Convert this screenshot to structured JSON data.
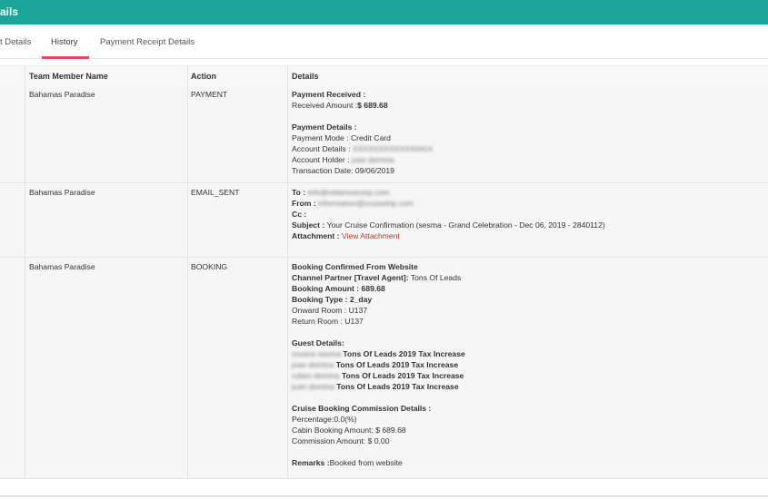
{
  "header": {
    "title": "ails"
  },
  "tabs": [
    {
      "label": "t Details"
    },
    {
      "label": "History"
    },
    {
      "label": "Payment Receipt Details"
    }
  ],
  "columns": {
    "team": "Team Member Name",
    "action": "Action",
    "details": "Details"
  },
  "rows": [
    {
      "team": "Bahamas Paradise",
      "action": "PAYMENT",
      "payment_received": "Payment Received :",
      "received_amount_label": "Received Amount :",
      "received_amount": "$ 689.68",
      "payment_details": "Payment Details :",
      "payment_mode": "Payment Mode : Credit Card",
      "account_details_label": "Account Details :",
      "account_details_value": "XXXXXXXXXXXX0414",
      "account_holder_label": "Account Holder :",
      "account_holder_value": "jose domina",
      "transaction_date": "Transaction Date: 09/06/2019"
    },
    {
      "team": "Bahamas Paradise",
      "action": "EMAIL_SENT",
      "to_label": "To :",
      "to_value": "info@vidamoscorp.com",
      "from_label": "From :",
      "from_value": "information@cruisetrip.com",
      "cc_label": "Cc :",
      "subject_label": "Subject :",
      "subject_value": "Your Cruise Confirmation (sesma - Grand Celebration - Dec 06, 2019 - 2840112)",
      "attachment_label": "Attachment :",
      "attachment_link": "View Attachment"
    },
    {
      "team": "Bahamas Paradise",
      "action": "BOOKING",
      "confirmed": "Booking Confirmed From Website",
      "channel_label": "Channel Partner [Travel Agent]:",
      "channel_value": "Tons Of Leads",
      "booking_amount": "Booking Amount : 689.68",
      "booking_type": "Booking Type : 2_day",
      "onward": "Onward Room : U137",
      "return": "Return Room : U137",
      "guest_details": "Guest Details:",
      "guests": [
        {
          "name": "roxana sesma",
          "note": "Tons Of Leads 2019 Tax Increase"
        },
        {
          "name": "jose domina",
          "note": "Tons Of Leads 2019 Tax Increase"
        },
        {
          "name": "ruben domina",
          "note": "Tons Of Leads 2019 Tax Increase"
        },
        {
          "name": "juan domina",
          "note": "Tons Of Leads 2019 Tax Increase"
        }
      ],
      "commission_title": "Cruise Booking Commission Details :",
      "percentage": "Percentage:0.0(%)",
      "cabin_amount": "Cabin Booking Amount: $ 689.68",
      "commission_amount": "Commission Amount: $ 0.00",
      "remarks_label": "Remarks :",
      "remarks_value": "Booked from website"
    }
  ]
}
